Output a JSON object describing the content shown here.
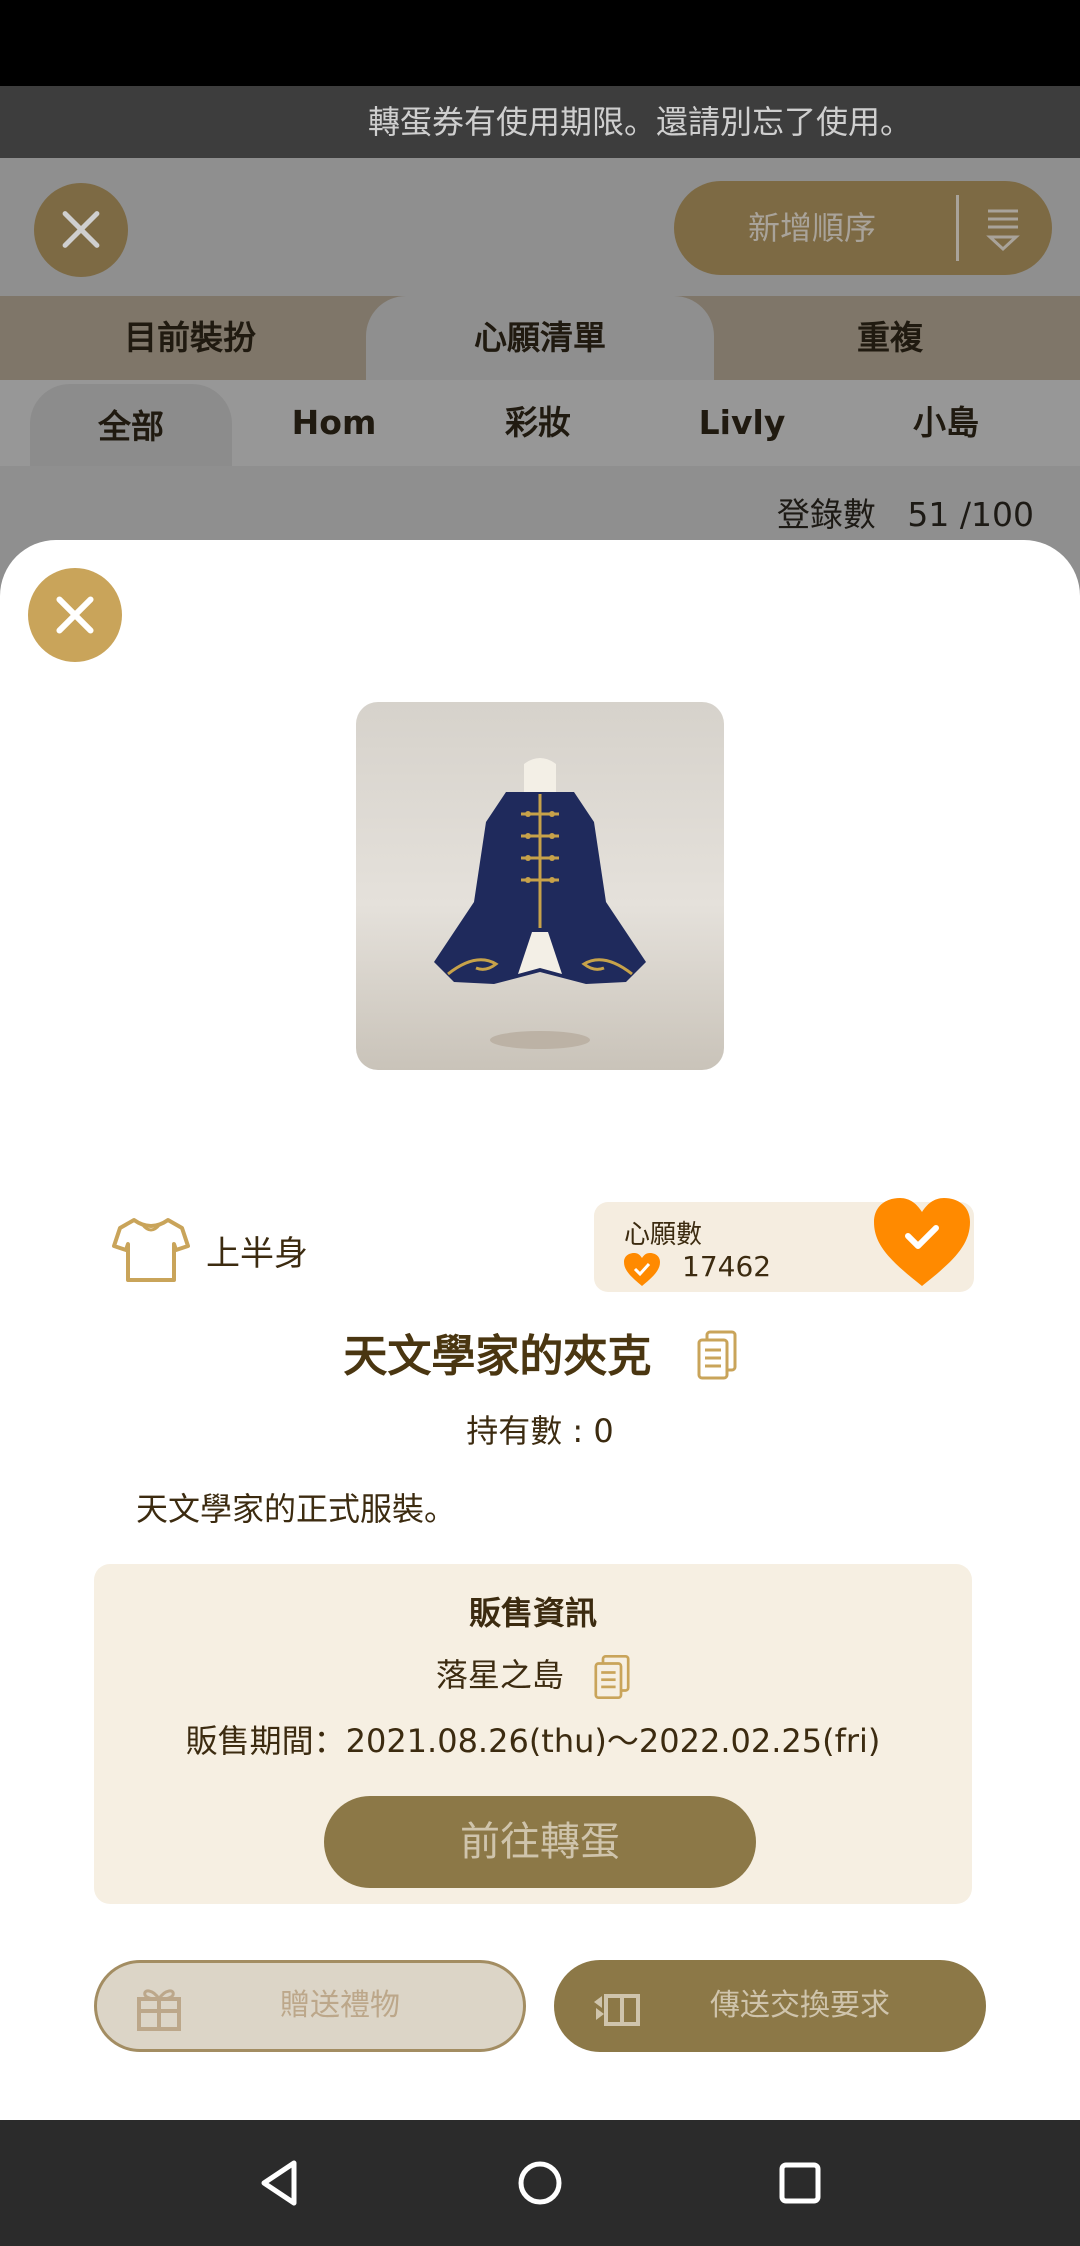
{
  "notice": "轉蛋券有使用期限。還請別忘了使用。",
  "sort_button": {
    "label": "新增順序"
  },
  "tabs": [
    "目前裝扮",
    "心願清單",
    "重複"
  ],
  "active_tab": 1,
  "subtabs": [
    "全部",
    "Hom",
    "彩妝",
    "Livly",
    "小島"
  ],
  "active_subtab": 0,
  "registered": {
    "label": "登錄數",
    "value": "51 /100"
  },
  "item": {
    "category": "上半身",
    "wish_label": "心願數",
    "wish_count": "17462",
    "name": "天文學家的夾克",
    "owned": "持有數 : 0",
    "description": "天文學家的正式服裝。"
  },
  "sale": {
    "heading": "販售資訊",
    "location": "落星之島",
    "period": "販售期間：2021.08.26(thu)～2022.02.25(fri)",
    "gacha_button": "前往轉蛋"
  },
  "actions": {
    "gift": "贈送禮物",
    "trade": "傳送交換要求"
  },
  "colors": {
    "accent": "#c9a45a",
    "heart": "#ff8a00",
    "button_brown": "#8c7847"
  }
}
